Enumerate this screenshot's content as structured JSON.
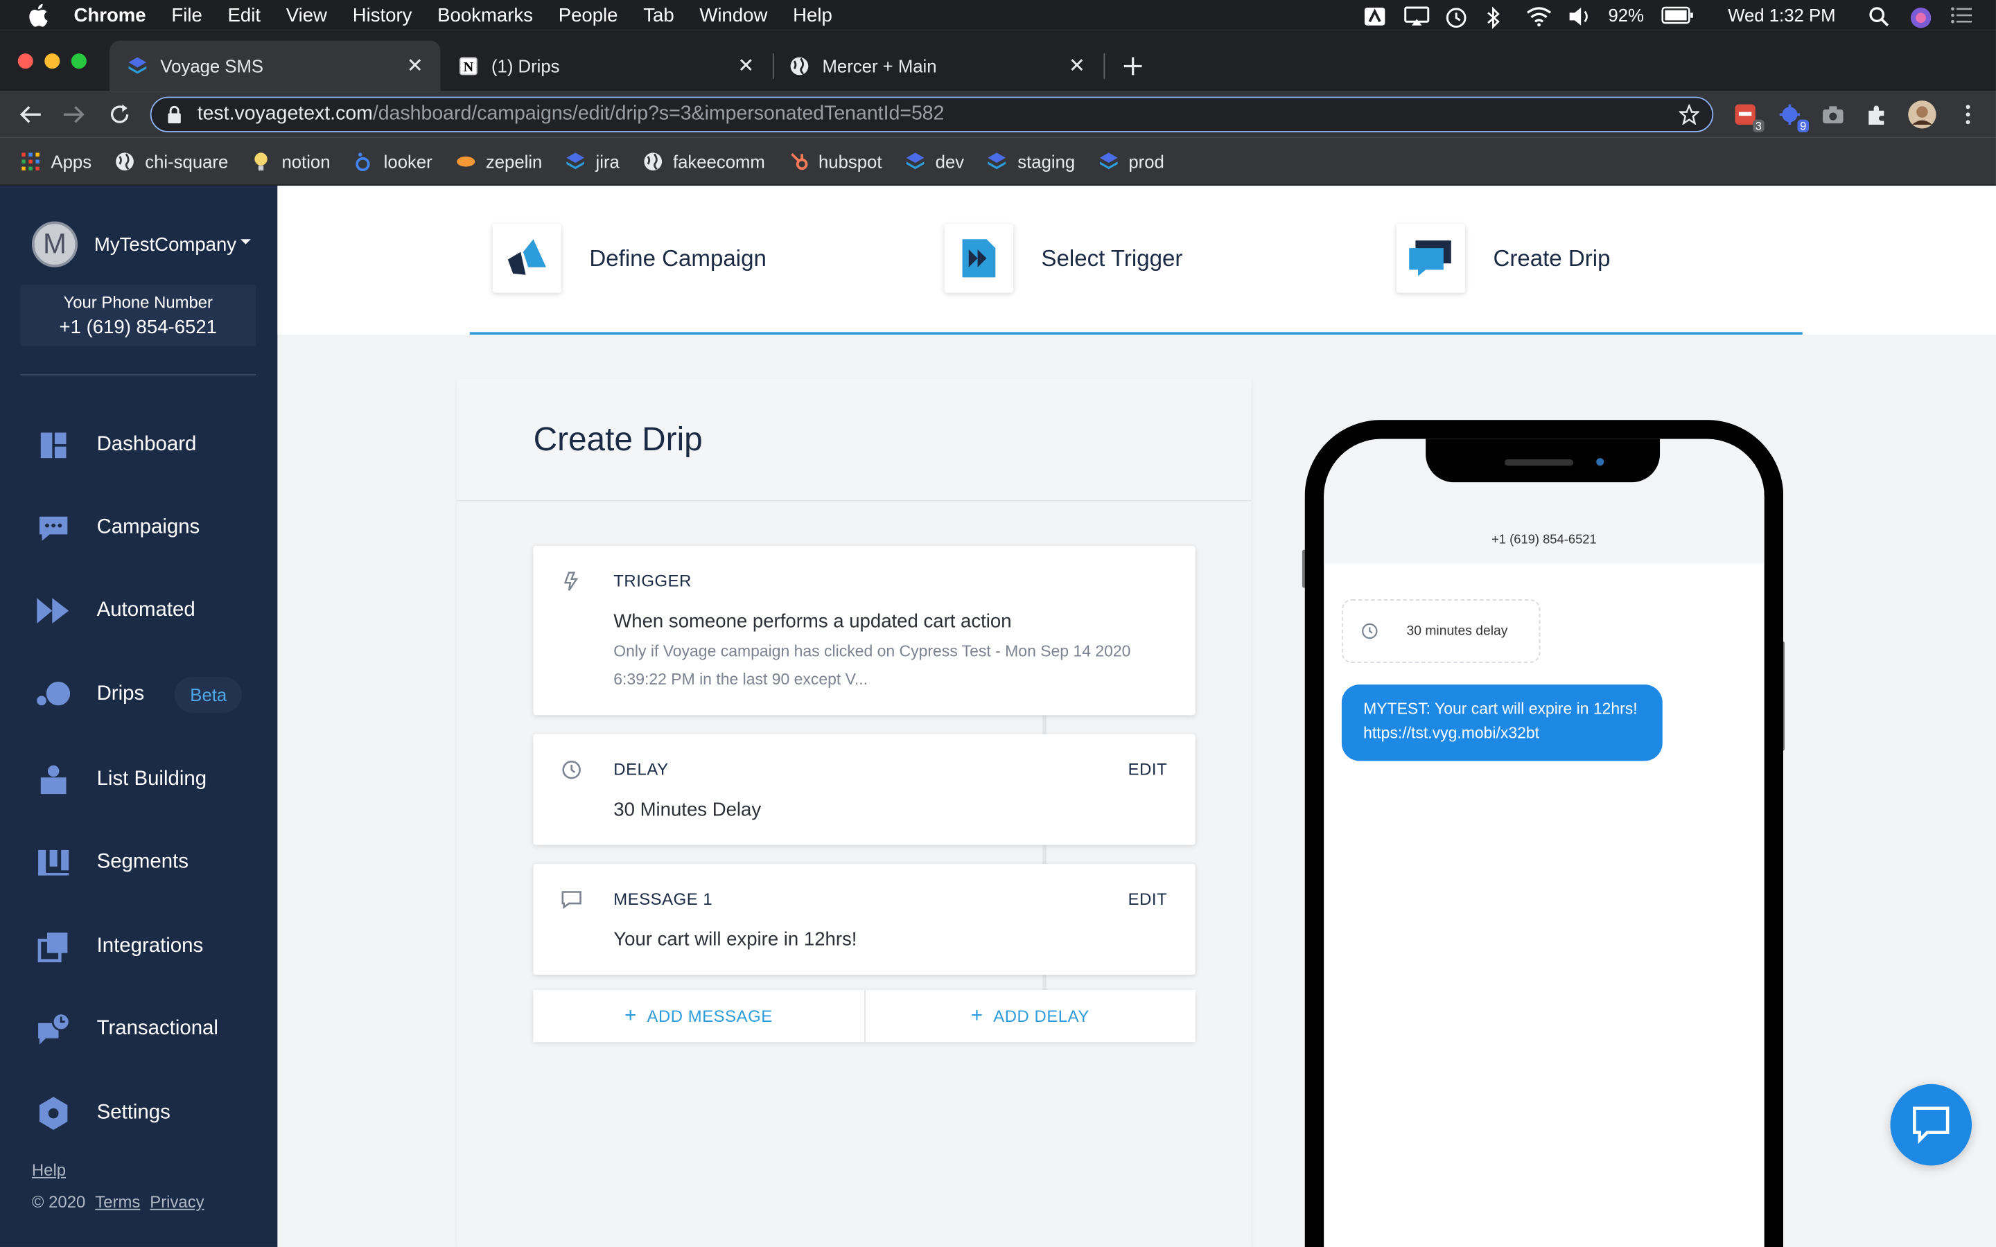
{
  "menubar": {
    "app": "Chrome",
    "items": [
      "File",
      "Edit",
      "View",
      "History",
      "Bookmarks",
      "People",
      "Tab",
      "Window",
      "Help"
    ],
    "battery": "92%",
    "clock": "Wed 1:32 PM"
  },
  "tabs": [
    {
      "title": "Voyage SMS",
      "active": true
    },
    {
      "title": "(1) Drips",
      "active": false
    },
    {
      "title": "Mercer + Main",
      "active": false
    }
  ],
  "address": {
    "host": "test.voyagetext.com",
    "path": "/dashboard/campaigns/edit/drip?s=3&impersonatedTenantId=582"
  },
  "extensions": {
    "badge1": "3",
    "badge2": "9"
  },
  "bookmarks": [
    "Apps",
    "chi-square",
    "notion",
    "looker",
    "zepelin",
    "jira",
    "fakeecomm",
    "hubspot",
    "dev",
    "staging",
    "prod"
  ],
  "sidebar": {
    "avatar_letter": "M",
    "company": "MyTestCompany",
    "phone_label": "Your Phone Number",
    "phone_number": "+1 (619) 854-6521",
    "items": [
      {
        "label": "Dashboard",
        "icon": "dashboard-icon"
      },
      {
        "label": "Campaigns",
        "icon": "chat-icon"
      },
      {
        "label": "Automated",
        "icon": "fast-forward-icon"
      },
      {
        "label": "Drips",
        "icon": "drips-icon",
        "badge": "Beta"
      },
      {
        "label": "List Building",
        "icon": "list-building-icon"
      },
      {
        "label": "Segments",
        "icon": "segments-icon"
      },
      {
        "label": "Integrations",
        "icon": "integrations-icon"
      },
      {
        "label": "Transactional",
        "icon": "transactional-icon"
      },
      {
        "label": "Settings",
        "icon": "settings-icon"
      }
    ],
    "help": "Help",
    "copyright": "© 2020",
    "terms": "Terms",
    "privacy": "Privacy"
  },
  "steps": [
    {
      "label": "Define Campaign"
    },
    {
      "label": "Select Trigger"
    },
    {
      "label": "Create Drip"
    }
  ],
  "card": {
    "title": "Create Drip",
    "trigger": {
      "title": "TRIGGER",
      "main": "When someone performs a updated cart action",
      "sub": "Only if Voyage campaign has clicked on Cypress Test - Mon Sep 14 2020 6:39:22 PM in the last 90 except V..."
    },
    "delay": {
      "title": "DELAY",
      "edit": "EDIT",
      "main": "30 Minutes Delay"
    },
    "message": {
      "title": "MESSAGE 1",
      "edit": "EDIT",
      "main": "Your cart will expire in 12hrs!"
    },
    "add_message": "ADD MESSAGE",
    "add_delay": "ADD DELAY",
    "plus": "+"
  },
  "phone": {
    "number": "+1 (619) 854-6521",
    "delay_text": "30 minutes delay",
    "message": "MYTEST: Your cart will expire in 12hrs! https://tst.vyg.mobi/x32bt"
  },
  "colors": {
    "sidebar": "#1b2a45",
    "accent": "#2d9cdb",
    "bubble": "#1e88e5"
  }
}
